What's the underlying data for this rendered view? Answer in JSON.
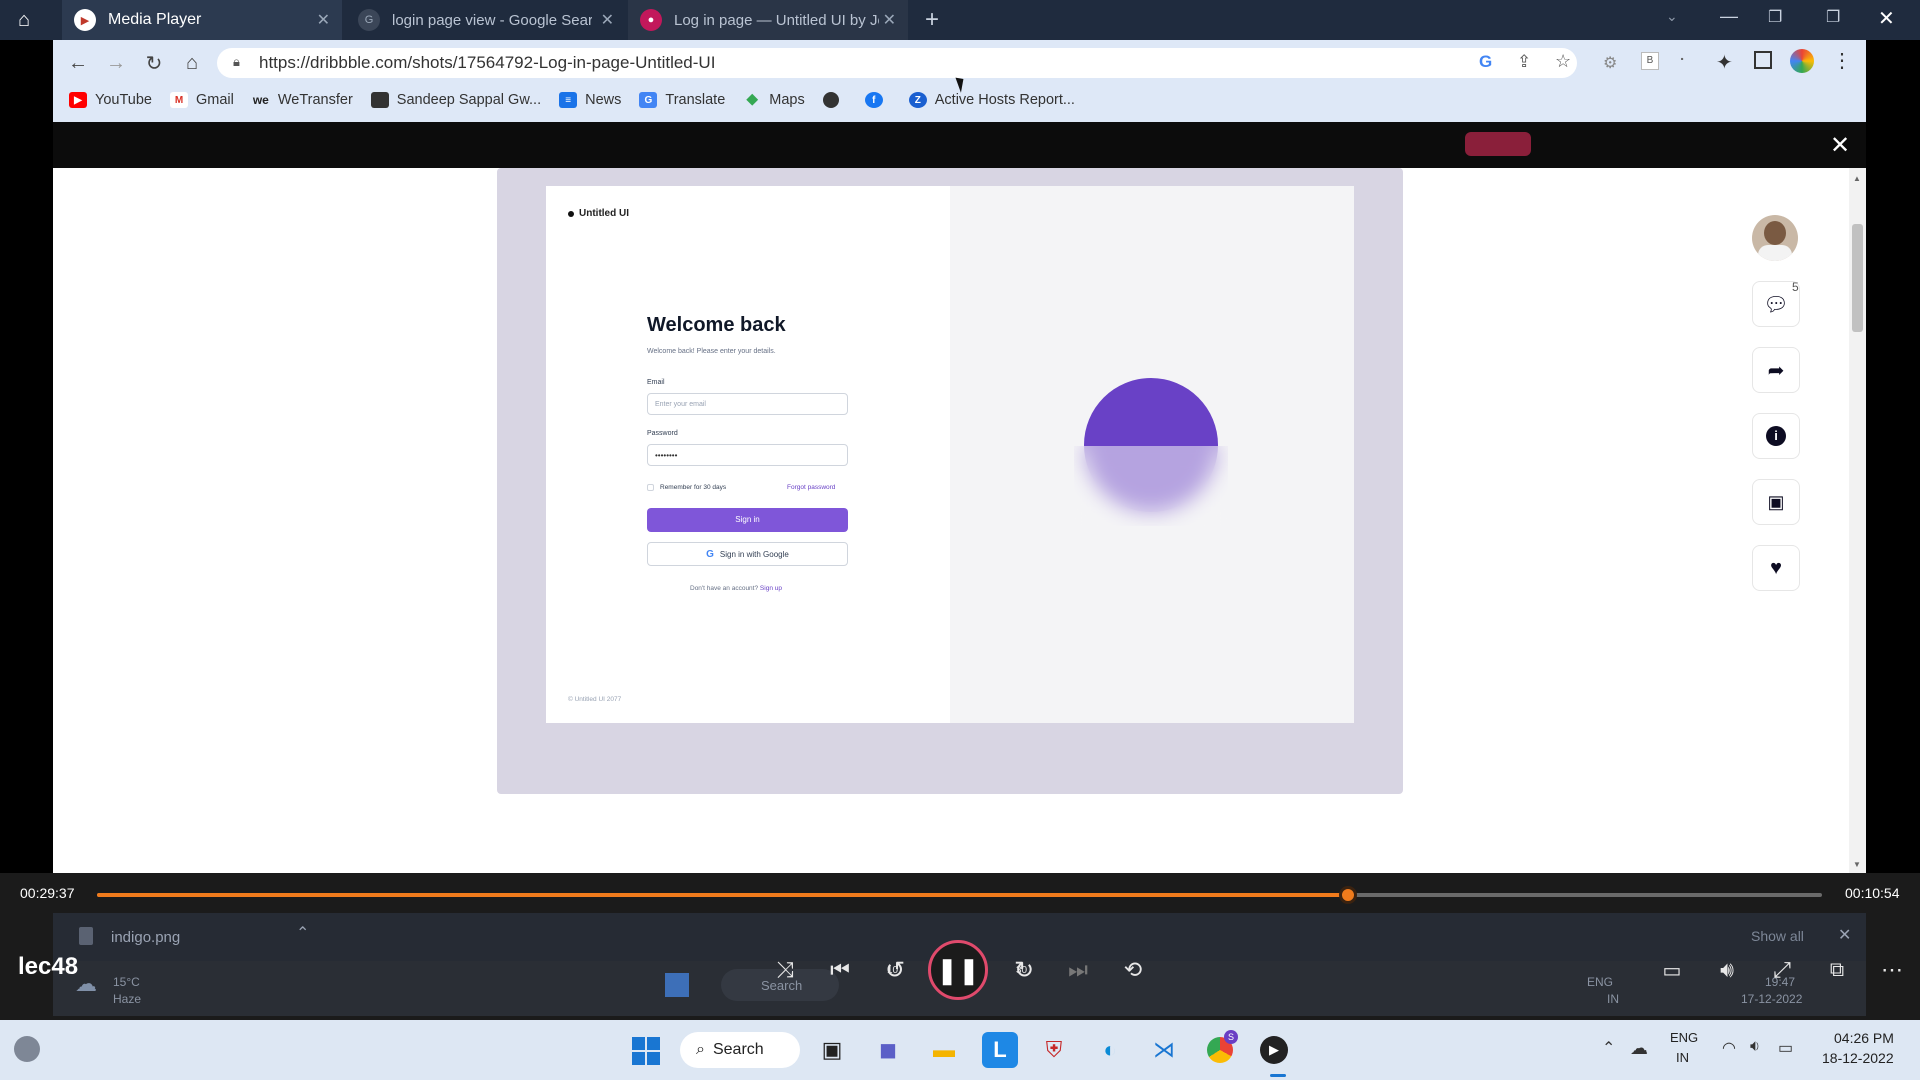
{
  "tabs": [
    {
      "title": "Media Player",
      "active": true
    },
    {
      "title": "login page view - Google Search",
      "active": false
    },
    {
      "title": "Log in page — Untitled UI by Jor",
      "active": false
    }
  ],
  "browser": {
    "url": "https://dribbble.com/shots/17564792-Log-in-page-Untitled-UI"
  },
  "bookmarks": [
    {
      "label": "YouTube",
      "icon": "youtube-icon",
      "color": "#ff0000"
    },
    {
      "label": "Gmail",
      "icon": "gmail-icon",
      "color": "#d93025"
    },
    {
      "label": "WeTransfer",
      "icon": "wetransfer-icon",
      "color": "#222222"
    },
    {
      "label": "Sandeep Sappal Gw...",
      "icon": "page-icon",
      "color": "#333333"
    },
    {
      "label": "News",
      "icon": "news-icon",
      "color": "#1a73e8"
    },
    {
      "label": "Translate",
      "icon": "translate-icon",
      "color": "#4285f4"
    },
    {
      "label": "Maps",
      "icon": "maps-icon",
      "color": "#34a853"
    },
    {
      "label": "",
      "icon": "globe-icon",
      "color": "#333333"
    },
    {
      "label": "",
      "icon": "facebook-icon",
      "color": "#1877f2"
    },
    {
      "label": "Active Hosts Report...",
      "icon": "zoho-icon",
      "color": "#1a5fd0"
    }
  ],
  "shot": {
    "brand": "Untitled UI",
    "heading": "Welcome back",
    "subheading": "Welcome back! Please enter your details.",
    "email_label": "Email",
    "email_placeholder": "Enter your email",
    "password_label": "Password",
    "password_value": "••••••••",
    "remember": "Remember for 30 days",
    "forgot": "Forgot password",
    "signin": "Sign in",
    "google": "Sign in with Google",
    "signup_prompt": "Don't have an account?",
    "signup": "Sign up",
    "footer": "© Untitled UI 2077",
    "accent": "#7f56d9"
  },
  "side": {
    "comments_count": "5"
  },
  "player": {
    "title": "lec48",
    "elapsed": "00:29:37",
    "remaining": "00:10:54",
    "progress": 0.725,
    "accent": "#f07b1c",
    "skip_back": "10",
    "skip_forward": "30"
  },
  "download": {
    "file": "indigo.png",
    "show_all": "Show all"
  },
  "ghost_taskbar": {
    "weather_temp": "15°C",
    "weather_desc": "Haze",
    "search": "Search",
    "lang1": "ENG",
    "lang2": "IN",
    "time": "19:47",
    "date": "17-12-2022"
  },
  "taskbar": {
    "search": "Search",
    "lang1": "ENG",
    "lang2": "IN",
    "time": "04:26 PM",
    "date": "18-12-2022",
    "chrome_badge": "S"
  }
}
